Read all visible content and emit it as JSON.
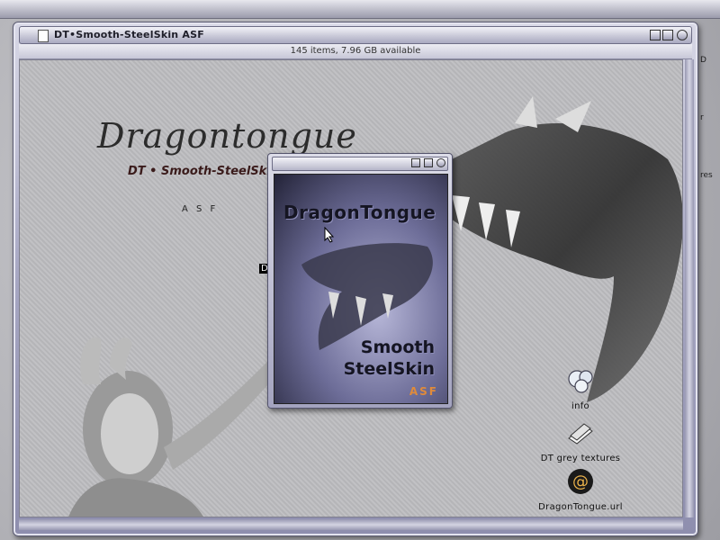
{
  "window": {
    "title": "DT•Smooth-SteelSkin ASF",
    "info": "145 items, 7.96 GB available"
  },
  "content": {
    "brand_title": "Dragontongue",
    "brand_subtitle": "DT • Smooth-SteelSkin",
    "asf_label": "A S F",
    "selected_label": "DT"
  },
  "popup": {
    "image_title": "DragonTongue",
    "image_sub_line1": "Smooth",
    "image_sub_line2": "SteelSkin",
    "image_badge": "ASF"
  },
  "desktop_icons": [
    {
      "label": "info",
      "icon": "drop-shape-icon"
    },
    {
      "label": "DT grey textures",
      "icon": "textures-folder-icon"
    },
    {
      "label": "DragonTongue.url",
      "icon": "at-sign-url-icon"
    }
  ],
  "desktop_edge": {
    "a": "D",
    "b": "r",
    "c": "res"
  },
  "colors": {
    "accent": "#a7a7c3",
    "badge": "#e08b3a"
  }
}
